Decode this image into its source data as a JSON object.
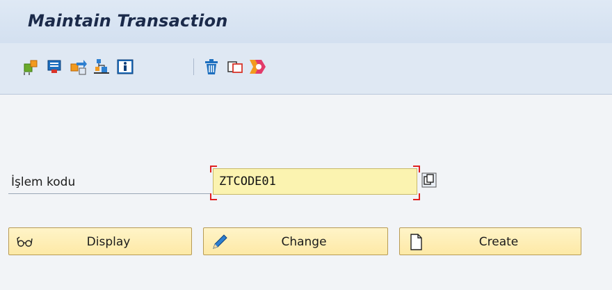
{
  "header": {
    "title": "Maintain Transaction"
  },
  "toolbar": {
    "items": [
      {
        "icon": "object-list-icon"
      },
      {
        "icon": "other-object-icon"
      },
      {
        "icon": "where-used-icon"
      },
      {
        "icon": "hierarchy-icon"
      },
      {
        "icon": "info-icon"
      },
      {
        "icon": "delete-icon"
      },
      {
        "icon": "copy-icon"
      },
      {
        "icon": "rename-icon"
      }
    ]
  },
  "form": {
    "tcode_label": "İşlem kodu",
    "tcode_value": "ZTCODE01"
  },
  "buttons": {
    "display": {
      "label": "Display",
      "icon": "glasses-icon"
    },
    "change": {
      "label": "Change",
      "icon": "pencil-icon"
    },
    "create": {
      "label": "Create",
      "icon": "blank-page-icon"
    }
  },
  "colors": {
    "title_bar": "#d3e0f0",
    "background": "#f2f4f7",
    "input_bg": "#fbf3b0",
    "button_bg": "#fde9a6",
    "required_marker": "#e02020",
    "icon_accent": "#f29a1f"
  }
}
